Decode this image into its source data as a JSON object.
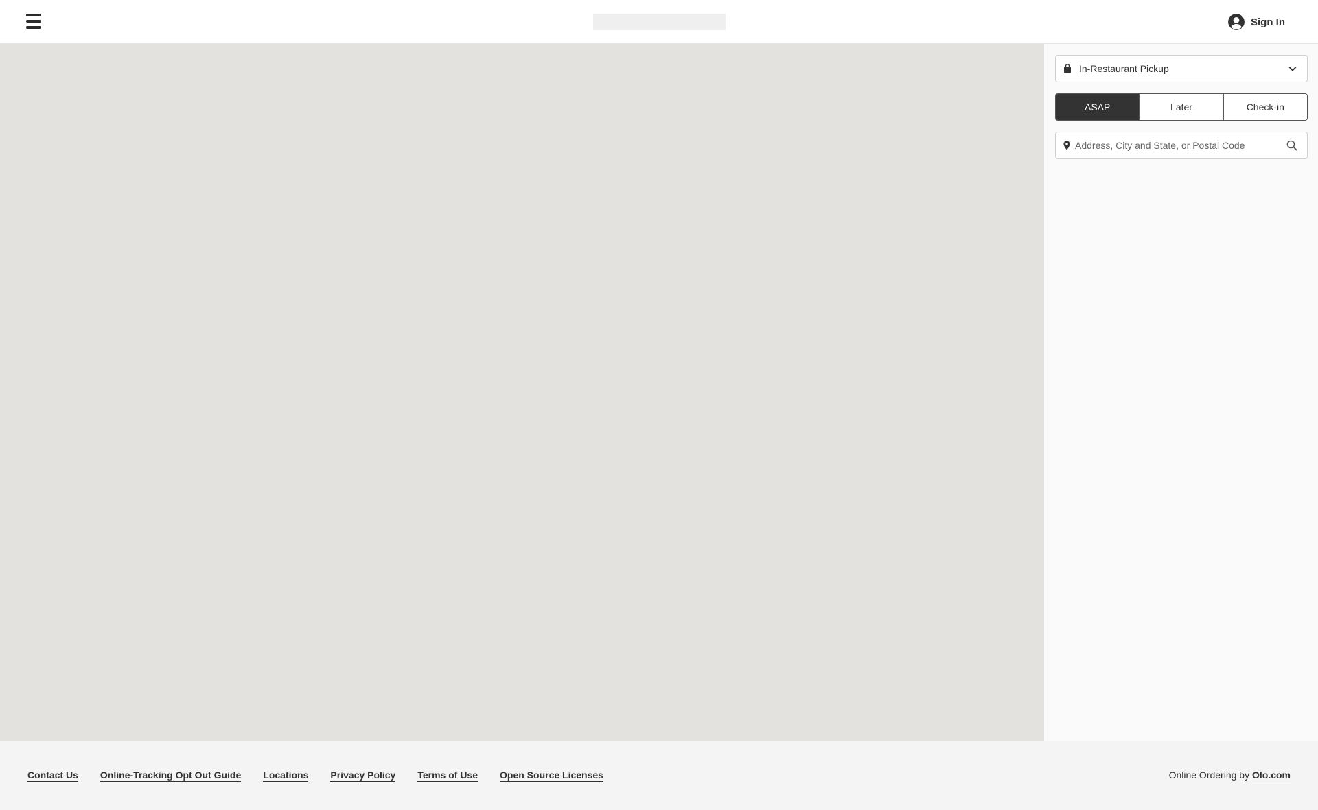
{
  "header": {
    "menu_icon": "hamburger-menu-icon",
    "account_icon": "user-circle-icon",
    "sign_in_label": "Sign In"
  },
  "panel": {
    "handoff": {
      "icon": "shopping-bag-icon",
      "selected": "In-Restaurant Pickup",
      "chevron_icon": "chevron-down-icon"
    },
    "time_mode": {
      "options": [
        "ASAP",
        "Later",
        "Check-in"
      ],
      "selected": "ASAP"
    },
    "search": {
      "pin_icon": "location-pin-icon",
      "placeholder": "Address, City and State, or Postal Code",
      "value": "",
      "search_icon": "search-icon"
    }
  },
  "footer": {
    "links": [
      "Contact Us",
      "Online-Tracking Opt Out Guide",
      "Locations",
      "Privacy Policy",
      "Terms of Use",
      "Open Source Licenses"
    ],
    "powered_prefix": "Online Ordering by",
    "powered_link": "Olo.com"
  },
  "colors": {
    "map_bg": "#e3e2df",
    "panel_bg": "#fafafa",
    "footer_bg": "#f4f4f4",
    "active_segment": "#333333"
  }
}
